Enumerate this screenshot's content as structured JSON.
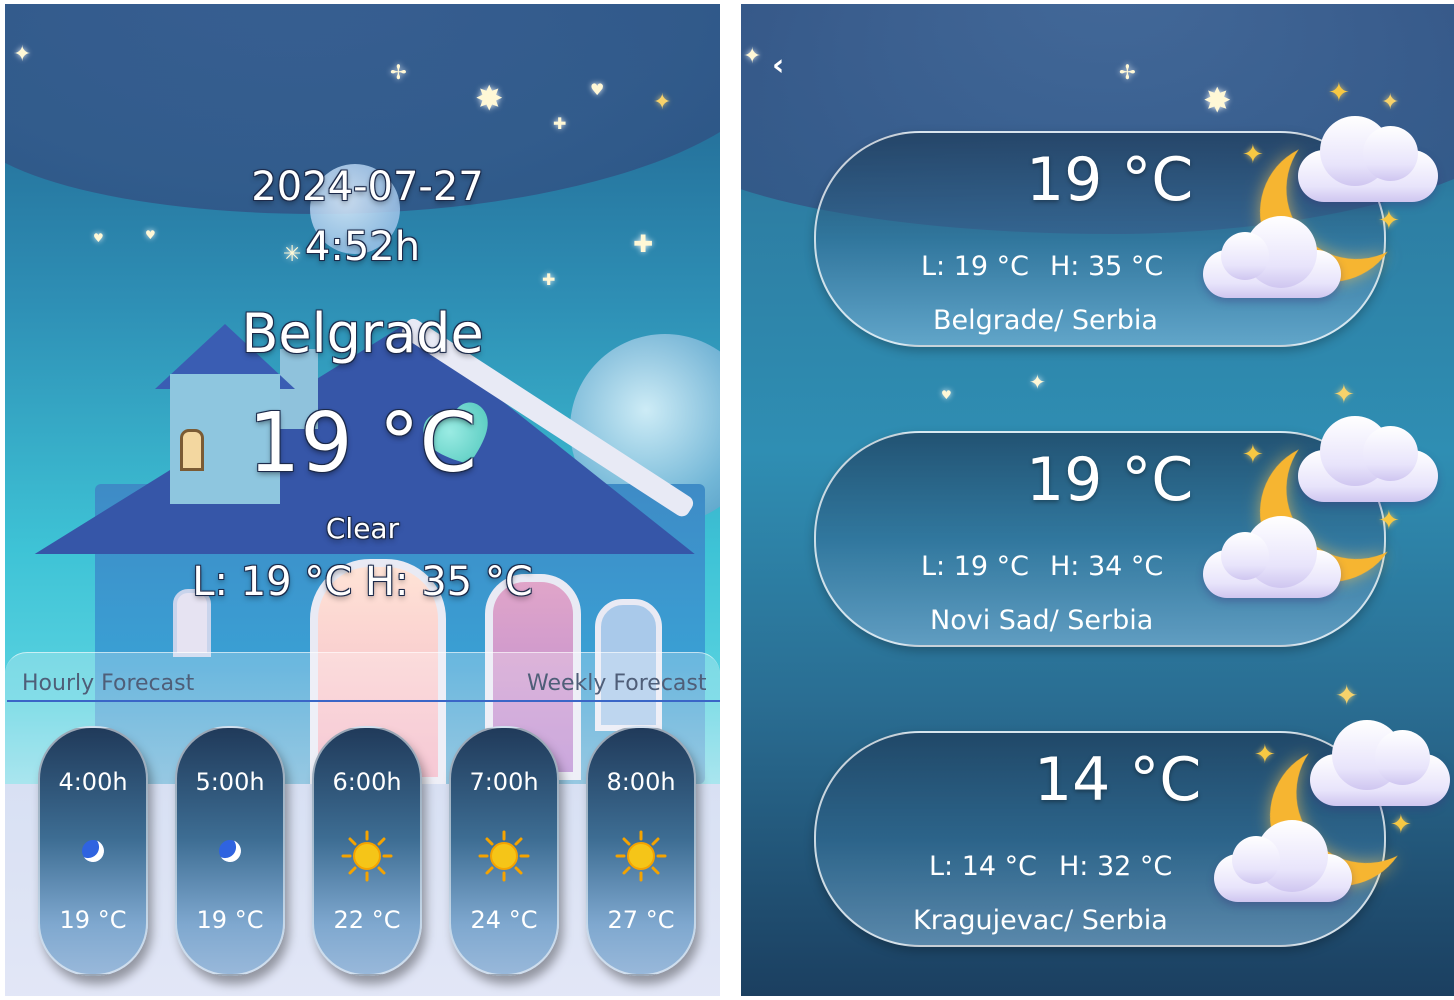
{
  "current": {
    "date": "2024-07-27",
    "time": "4:52h",
    "city": "Belgrade",
    "temperature": "19 °C",
    "condition": "Clear",
    "low_high": "L: 19 °C H: 35 °C"
  },
  "forecast_tabs": {
    "hourly": "Hourly Forecast",
    "weekly": "Weekly Forecast"
  },
  "hourly": [
    {
      "time": "4:00h",
      "icon": "moon-icon",
      "temp": "19 °C"
    },
    {
      "time": "5:00h",
      "icon": "moon-icon",
      "temp": "19 °C"
    },
    {
      "time": "6:00h",
      "icon": "sun-icon",
      "temp": "22 °C"
    },
    {
      "time": "7:00h",
      "icon": "sun-icon",
      "temp": "24 °C"
    },
    {
      "time": "8:00h",
      "icon": "sun-icon",
      "temp": "27 °C"
    }
  ],
  "cities": [
    {
      "temp": "19 °C",
      "low": "L: 19 °C",
      "high": "H: 35 °C",
      "name": "Belgrade/ Serbia",
      "icon": "moon-cloud-icon"
    },
    {
      "temp": "19 °C",
      "low": "L: 19 °C",
      "high": "H: 34 °C",
      "name": "Novi Sad/ Serbia",
      "icon": "moon-cloud-icon"
    },
    {
      "temp": "14 °C",
      "low": "L: 14 °C",
      "high": "H: 32 °C",
      "name": "Kragujevac/ Serbia",
      "icon": "moon-cloud-icon"
    }
  ],
  "colors": {
    "tab_underline": "#3a66c7",
    "moon_icon": "#2f63e0",
    "sun_icon": "#f5c518",
    "crescent": "#f6b531"
  }
}
